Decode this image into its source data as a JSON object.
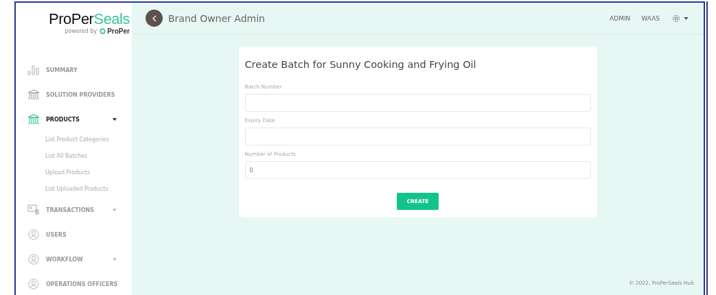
{
  "logo": {
    "name_dark": "ProPer",
    "name_accent": "Seals",
    "powered_by": "powered by",
    "sub_brand": "ProPer"
  },
  "sidebar": {
    "items": [
      {
        "label": "SUMMARY",
        "kind": "link",
        "selected": false
      },
      {
        "label": "SOLUTION PROVIDERS",
        "kind": "link",
        "selected": false
      },
      {
        "label": "PRODUCTS",
        "kind": "group",
        "selected": true,
        "expanded": true,
        "children": [
          {
            "label": "List Product Categories"
          },
          {
            "label": "List All Batches"
          },
          {
            "label": "Upload Products"
          },
          {
            "label": "List Uploaded Products"
          }
        ]
      },
      {
        "label": "TRANSACTIONS",
        "kind": "group",
        "selected": false,
        "expanded": false
      },
      {
        "label": "USERS",
        "kind": "link",
        "selected": false
      },
      {
        "label": "WORKFLOW",
        "kind": "group",
        "selected": false,
        "expanded": false
      },
      {
        "label": "OPERATIONS OFFICERS",
        "kind": "link",
        "selected": false
      }
    ]
  },
  "header": {
    "title": "Brand Owner Admin",
    "links": [
      "ADMIN",
      "WAAS"
    ]
  },
  "form": {
    "title": "Create Batch for Sunny Cooking and Frying Oil",
    "fields": [
      {
        "label": "Batch Number"
      },
      {
        "label": "Expiry Date"
      },
      {
        "label": "Number of Products",
        "value": "0"
      }
    ],
    "submit": "CREATE"
  },
  "footer": "© 2022, ProPerSeals Hub"
}
